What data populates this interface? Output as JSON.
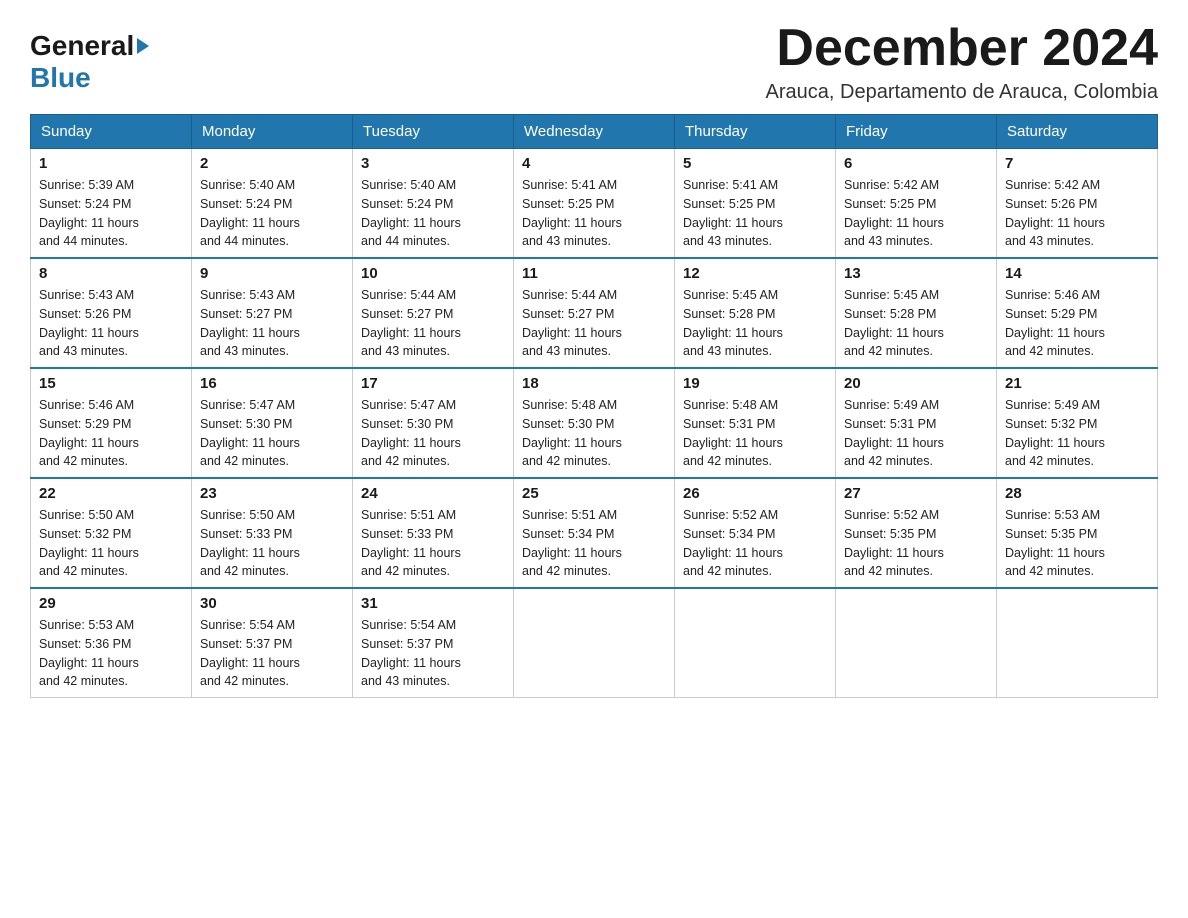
{
  "header": {
    "logo_general": "General",
    "logo_blue": "Blue",
    "month_title": "December 2024",
    "location": "Arauca, Departamento de Arauca, Colombia"
  },
  "days_of_week": [
    "Sunday",
    "Monday",
    "Tuesday",
    "Wednesday",
    "Thursday",
    "Friday",
    "Saturday"
  ],
  "weeks": [
    [
      {
        "day": "1",
        "sunrise": "5:39 AM",
        "sunset": "5:24 PM",
        "daylight": "11 hours and 44 minutes."
      },
      {
        "day": "2",
        "sunrise": "5:40 AM",
        "sunset": "5:24 PM",
        "daylight": "11 hours and 44 minutes."
      },
      {
        "day": "3",
        "sunrise": "5:40 AM",
        "sunset": "5:24 PM",
        "daylight": "11 hours and 44 minutes."
      },
      {
        "day": "4",
        "sunrise": "5:41 AM",
        "sunset": "5:25 PM",
        "daylight": "11 hours and 43 minutes."
      },
      {
        "day": "5",
        "sunrise": "5:41 AM",
        "sunset": "5:25 PM",
        "daylight": "11 hours and 43 minutes."
      },
      {
        "day": "6",
        "sunrise": "5:42 AM",
        "sunset": "5:25 PM",
        "daylight": "11 hours and 43 minutes."
      },
      {
        "day": "7",
        "sunrise": "5:42 AM",
        "sunset": "5:26 PM",
        "daylight": "11 hours and 43 minutes."
      }
    ],
    [
      {
        "day": "8",
        "sunrise": "5:43 AM",
        "sunset": "5:26 PM",
        "daylight": "11 hours and 43 minutes."
      },
      {
        "day": "9",
        "sunrise": "5:43 AM",
        "sunset": "5:27 PM",
        "daylight": "11 hours and 43 minutes."
      },
      {
        "day": "10",
        "sunrise": "5:44 AM",
        "sunset": "5:27 PM",
        "daylight": "11 hours and 43 minutes."
      },
      {
        "day": "11",
        "sunrise": "5:44 AM",
        "sunset": "5:27 PM",
        "daylight": "11 hours and 43 minutes."
      },
      {
        "day": "12",
        "sunrise": "5:45 AM",
        "sunset": "5:28 PM",
        "daylight": "11 hours and 43 minutes."
      },
      {
        "day": "13",
        "sunrise": "5:45 AM",
        "sunset": "5:28 PM",
        "daylight": "11 hours and 42 minutes."
      },
      {
        "day": "14",
        "sunrise": "5:46 AM",
        "sunset": "5:29 PM",
        "daylight": "11 hours and 42 minutes."
      }
    ],
    [
      {
        "day": "15",
        "sunrise": "5:46 AM",
        "sunset": "5:29 PM",
        "daylight": "11 hours and 42 minutes."
      },
      {
        "day": "16",
        "sunrise": "5:47 AM",
        "sunset": "5:30 PM",
        "daylight": "11 hours and 42 minutes."
      },
      {
        "day": "17",
        "sunrise": "5:47 AM",
        "sunset": "5:30 PM",
        "daylight": "11 hours and 42 minutes."
      },
      {
        "day": "18",
        "sunrise": "5:48 AM",
        "sunset": "5:30 PM",
        "daylight": "11 hours and 42 minutes."
      },
      {
        "day": "19",
        "sunrise": "5:48 AM",
        "sunset": "5:31 PM",
        "daylight": "11 hours and 42 minutes."
      },
      {
        "day": "20",
        "sunrise": "5:49 AM",
        "sunset": "5:31 PM",
        "daylight": "11 hours and 42 minutes."
      },
      {
        "day": "21",
        "sunrise": "5:49 AM",
        "sunset": "5:32 PM",
        "daylight": "11 hours and 42 minutes."
      }
    ],
    [
      {
        "day": "22",
        "sunrise": "5:50 AM",
        "sunset": "5:32 PM",
        "daylight": "11 hours and 42 minutes."
      },
      {
        "day": "23",
        "sunrise": "5:50 AM",
        "sunset": "5:33 PM",
        "daylight": "11 hours and 42 minutes."
      },
      {
        "day": "24",
        "sunrise": "5:51 AM",
        "sunset": "5:33 PM",
        "daylight": "11 hours and 42 minutes."
      },
      {
        "day": "25",
        "sunrise": "5:51 AM",
        "sunset": "5:34 PM",
        "daylight": "11 hours and 42 minutes."
      },
      {
        "day": "26",
        "sunrise": "5:52 AM",
        "sunset": "5:34 PM",
        "daylight": "11 hours and 42 minutes."
      },
      {
        "day": "27",
        "sunrise": "5:52 AM",
        "sunset": "5:35 PM",
        "daylight": "11 hours and 42 minutes."
      },
      {
        "day": "28",
        "sunrise": "5:53 AM",
        "sunset": "5:35 PM",
        "daylight": "11 hours and 42 minutes."
      }
    ],
    [
      {
        "day": "29",
        "sunrise": "5:53 AM",
        "sunset": "5:36 PM",
        "daylight": "11 hours and 42 minutes."
      },
      {
        "day": "30",
        "sunrise": "5:54 AM",
        "sunset": "5:37 PM",
        "daylight": "11 hours and 42 minutes."
      },
      {
        "day": "31",
        "sunrise": "5:54 AM",
        "sunset": "5:37 PM",
        "daylight": "11 hours and 43 minutes."
      },
      null,
      null,
      null,
      null
    ]
  ]
}
